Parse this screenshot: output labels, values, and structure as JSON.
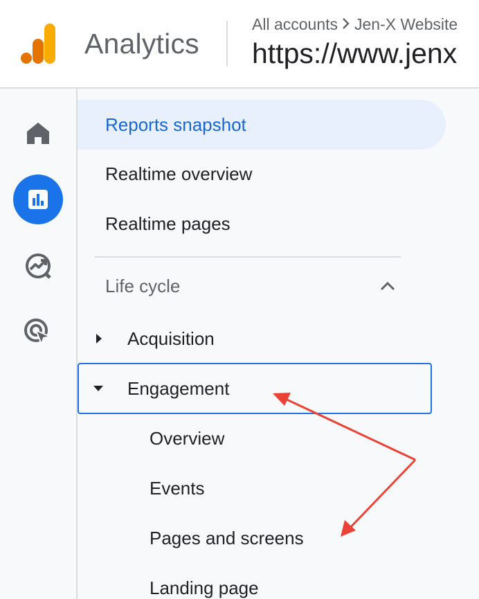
{
  "header": {
    "app_name": "Analytics",
    "breadcrumb": {
      "account_root": "All accounts",
      "account_name": "Jen-X Website"
    },
    "property_url": "https://www.jenx"
  },
  "rail": {
    "items": [
      {
        "icon": "home-icon"
      },
      {
        "icon": "reports-icon",
        "active": true
      },
      {
        "icon": "explore-icon"
      },
      {
        "icon": "advertising-icon"
      }
    ]
  },
  "nav": {
    "reports_snapshot": "Reports snapshot",
    "realtime_overview": "Realtime overview",
    "realtime_pages": "Realtime pages",
    "section_lifecycle": "Life cycle",
    "acquisition": "Acquisition",
    "engagement": "Engagement",
    "engagement_children": [
      "Overview",
      "Events",
      "Pages and screens",
      "Landing page"
    ]
  },
  "colors": {
    "accent": "#1a73e8",
    "selected_bg": "#e8f0fe",
    "selected_text": "#1967d2",
    "annotation_arrow": "#ea4335",
    "logo_orange": "#f9ab00",
    "logo_dark_orange": "#e37400"
  }
}
